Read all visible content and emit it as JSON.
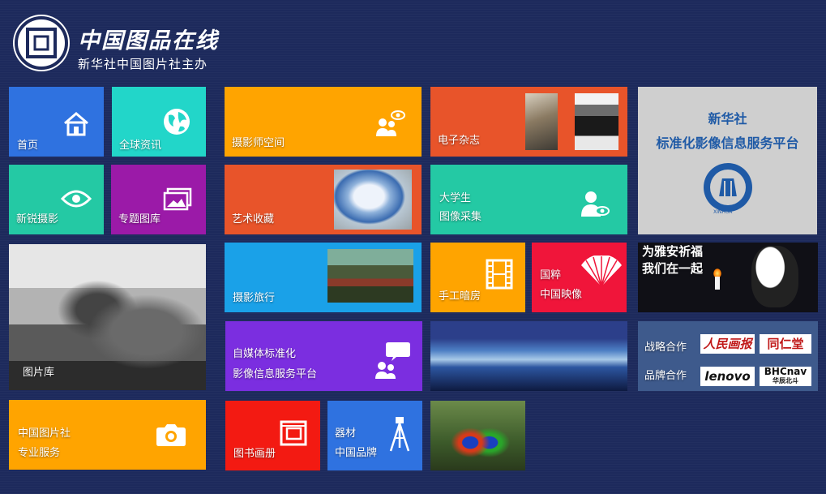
{
  "header": {
    "logo_title": "中国图品在线",
    "logo_subtitle": "新华社中国图片社主办"
  },
  "tiles": {
    "home": "首页",
    "global_news": "全球资讯",
    "photographer_space": "摄影师空间",
    "emagazine": "电子杂志",
    "xinhua_platform_line1": "新华社",
    "xinhua_platform_line2": "标准化影像信息服务平台",
    "xinhua_emblem_text": "XINHUA",
    "new_photography": "新锐摄影",
    "topic_gallery": "专题图库",
    "art_collection": "艺术收藏",
    "student_line1": "大学生",
    "student_line2": "图像采集",
    "gallery": "图片库",
    "photo_travel": "摄影旅行",
    "darkroom": "手工暗房",
    "guocui_line1": "国粹",
    "guocui_line2": "中国映像",
    "yaan_line1": "为雅安祈福",
    "yaan_line2": "我们在一起",
    "selfmedia_line1": "自媒体标准化",
    "selfmedia_line2": "影像信息服务平台",
    "strategic_partner": "战略合作",
    "brand_partner": "品牌合作",
    "partner_renmin": "人民画报",
    "partner_tongrentang": "同仁堂",
    "partner_lenovo": "lenovo",
    "partner_bhcnav": "BHCnav",
    "partner_bhcnav_sub": "华辰北斗",
    "cpa_line1": "中国图片社",
    "cpa_line2": "专业服务",
    "books": "图书画册",
    "equipment_line1": "器材",
    "equipment_line2": "中国品牌"
  },
  "colors": {
    "background": "#1d2a5c",
    "blue": "#2f72e0",
    "cyan": "#22d6c9",
    "orange": "#ffa400",
    "red_orange": "#e8542a",
    "teal": "#24c9a4",
    "purple": "#9b1aa8",
    "sky": "#1aa1e8",
    "red": "#f0153a",
    "violet": "#7b2ee0",
    "bright_red": "#f31a12",
    "gray": "#cfcfcf",
    "slate": "#3e5a8c"
  }
}
